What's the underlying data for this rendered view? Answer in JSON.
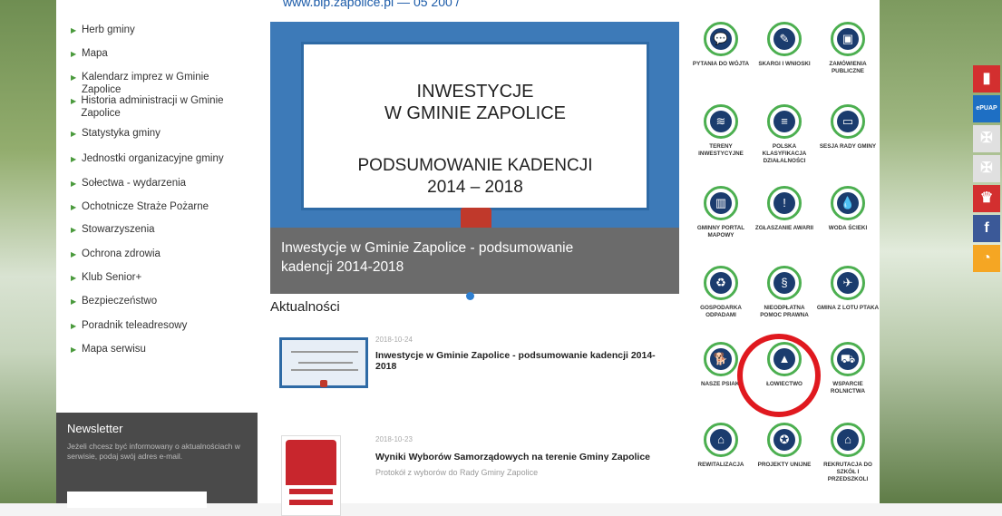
{
  "top_link": "www.bip.zapolice.pl — 05 200  /",
  "sidebar": {
    "items": [
      {
        "label": "Herb gminy"
      },
      {
        "label": "Mapa"
      },
      {
        "label": "Kalendarz imprez w Gminie Zapolice"
      },
      {
        "label": "Historia administracji w Gminie Zapolice"
      },
      {
        "label": "Statystyka gminy"
      },
      {
        "label": "Jednostki organizacyjne gminy"
      },
      {
        "label": "Sołectwa - wydarzenia"
      },
      {
        "label": "Ochotnicze Straże Pożarne"
      },
      {
        "label": "Stowarzyszenia"
      },
      {
        "label": "Ochrona zdrowia"
      },
      {
        "label": "Klub Senior+"
      },
      {
        "label": "Bezpieczeństwo"
      },
      {
        "label": "Poradnik teleadresowy"
      },
      {
        "label": "Mapa serwisu"
      }
    ]
  },
  "newsletter": {
    "title": "Newsletter",
    "text": "Jeżeli chcesz być informowany o aktualnościach w serwisie, podaj swój adres e-mail."
  },
  "slider": {
    "line1": "INWESTYCJE",
    "line2": "W GMINIE ZAPOLICE",
    "line3": "PODSUMOWANIE KADENCJI",
    "line4": "2014 – 2018",
    "caption": "Inwestycje w Gminie Zapolice - podsumowanie kadencji 2014-2018"
  },
  "news": {
    "heading": "Aktualności",
    "items": [
      {
        "date": "2018-10-24",
        "title": "Inwestycje w Gminie Zapolice - podsumowanie kadencji 2014-2018",
        "sub": ""
      },
      {
        "date": "2018-10-23",
        "title": "Wyniki Wyborów Samorządowych na terenie Gminy Zapolice",
        "sub": "Protokół z wyborów do Rady Gminy Zapolice"
      }
    ]
  },
  "tiles": [
    {
      "label": "PYTANIA DO WÓJTA",
      "icon": "chat-icon",
      "glyph": "💬"
    },
    {
      "label": "SKARGI I WNIOSKI",
      "icon": "pencil-icon",
      "glyph": "✎"
    },
    {
      "label": "ZAMÓWIENIA PUBLICZNE",
      "icon": "money-icon",
      "glyph": "▣"
    },
    {
      "label": "TERENY INWESTYCYJNE",
      "icon": "field-icon",
      "glyph": "≋"
    },
    {
      "label": "POLSKA KLASYFIKACJA DZIAŁALNOŚCI",
      "icon": "database-icon",
      "glyph": "≡"
    },
    {
      "label": "SESJA RADY GMINY",
      "icon": "monitor-icon",
      "glyph": "▭"
    },
    {
      "label": "GMINNY PORTAL MAPOWY",
      "icon": "map-icon",
      "glyph": "▥"
    },
    {
      "label": "ZGŁASZANIE AWARII",
      "icon": "warning-icon",
      "glyph": "!"
    },
    {
      "label": "WODA ŚCIEKI",
      "icon": "water-drop-icon",
      "glyph": "💧"
    },
    {
      "label": "GOSPODARKA ODPADAMI",
      "icon": "recycle-icon",
      "glyph": "♻"
    },
    {
      "label": "NIEODPŁATNA POMOC PRAWNA",
      "icon": "paragraph-icon",
      "glyph": "§"
    },
    {
      "label": "GMINA Z LOTU PTAKA",
      "icon": "plane-icon",
      "glyph": "✈"
    },
    {
      "label": "NASZE PSIAKI",
      "icon": "dog-icon",
      "glyph": "🐕"
    },
    {
      "label": "ŁOWIECTWO",
      "icon": "tree-icon",
      "glyph": "▲"
    },
    {
      "label": "WSPARCIE ROLNICTWA",
      "icon": "tractor-icon",
      "glyph": "⛟"
    },
    {
      "label": "REWITALIZACJA",
      "icon": "building-icon",
      "glyph": "⌂"
    },
    {
      "label": "PROJEKTY UNIJNE",
      "icon": "eu-stars-icon",
      "glyph": "✪"
    },
    {
      "label": "REKRUTACJA DO SZKÓŁ I PRZEDSZKOLI",
      "icon": "school-icon",
      "glyph": "⌂"
    }
  ],
  "social": [
    {
      "name": "bip-icon",
      "glyph": "▮",
      "color": "#d32f2f"
    },
    {
      "name": "epuap-icon",
      "glyph": "ePUAP",
      "color": "#1e6fc4"
    },
    {
      "name": "emblem-icon",
      "glyph": "✠",
      "color": "#e0e0e0"
    },
    {
      "name": "emblem2-icon",
      "glyph": "✠",
      "color": "#e0e0e0"
    },
    {
      "name": "poland-emblem-icon",
      "glyph": "♛",
      "color": "#d32f2f"
    },
    {
      "name": "facebook-icon",
      "glyph": "f",
      "color": "#3b5998"
    },
    {
      "name": "rss-icon",
      "glyph": "◔",
      "color": "#f5a623"
    }
  ],
  "colors": {
    "accent_green": "#4caf50",
    "icon_navy": "#1b3c6e",
    "annotation_red": "#e0191f",
    "slider_blue": "#3d7ab8"
  }
}
